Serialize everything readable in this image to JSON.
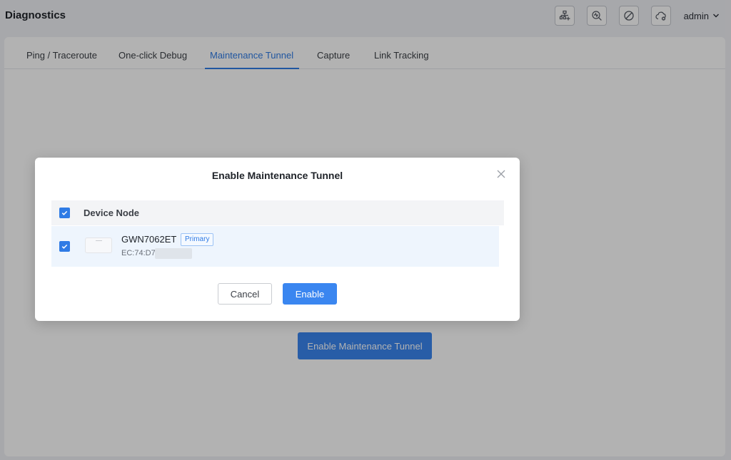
{
  "header": {
    "title": "Diagnostics",
    "icons": [
      "network-topology-icon",
      "diagnostics-search-icon",
      "block-icon",
      "cloud-disconnected-icon"
    ],
    "user": "admin"
  },
  "tabs": [
    {
      "label": "Ping / Traceroute",
      "active": false
    },
    {
      "label": "One-click Debug",
      "active": false
    },
    {
      "label": "Maintenance Tunnel",
      "active": true
    },
    {
      "label": "Capture",
      "active": false
    },
    {
      "label": "Link Tracking",
      "active": false
    }
  ],
  "background_button": "Enable Maintenance Tunnel",
  "modal": {
    "title": "Enable Maintenance Tunnel",
    "table_header": "Device Node",
    "header_checked": true,
    "device": {
      "name": "GWN7062ET",
      "badge": "Primary",
      "mac": "EC:74:D7",
      "checked": true
    },
    "cancel_label": "Cancel",
    "enable_label": "Enable"
  },
  "colors": {
    "accent": "#2f7be5",
    "button": "#3a86f0",
    "overlay": "rgba(0,0,0,0.30)"
  }
}
